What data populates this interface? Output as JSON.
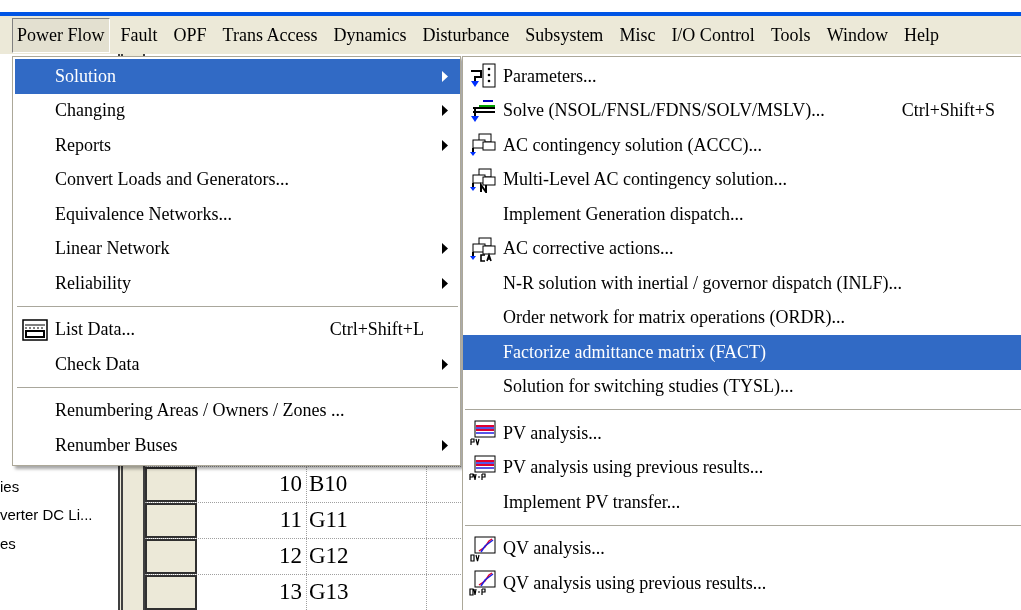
{
  "menubar": [
    {
      "label": "Power Flow",
      "selected": true
    },
    {
      "label": "Fault",
      "selected": false
    },
    {
      "label": "OPF",
      "selected": false
    },
    {
      "label": "Trans Access",
      "selected": false
    },
    {
      "label": "Dynamics",
      "selected": false
    },
    {
      "label": "Disturbance",
      "selected": false
    },
    {
      "label": "Subsystem",
      "selected": false
    },
    {
      "label": "Misc",
      "selected": false
    },
    {
      "label": "I/O Control",
      "selected": false
    },
    {
      "label": "Tools",
      "selected": false
    },
    {
      "label": "Window",
      "selected": false
    },
    {
      "label": "Help",
      "selected": false
    }
  ],
  "menu": {
    "items": [
      {
        "kind": "item",
        "label": "Solution",
        "has_submenu": true,
        "selected": true
      },
      {
        "kind": "item",
        "label": "Changing",
        "has_submenu": true,
        "selected": false
      },
      {
        "kind": "item",
        "label": "Reports",
        "has_submenu": true,
        "selected": false
      },
      {
        "kind": "item",
        "label": "Convert Loads and Generators...",
        "has_submenu": false,
        "selected": false
      },
      {
        "kind": "item",
        "label": "Equivalence Networks...",
        "has_submenu": false,
        "selected": false
      },
      {
        "kind": "item",
        "label": "Linear Network",
        "has_submenu": true,
        "selected": false
      },
      {
        "kind": "item",
        "label": "Reliability",
        "has_submenu": true,
        "selected": false
      },
      {
        "kind": "separator"
      },
      {
        "kind": "item",
        "label": "List Data...",
        "shortcut": "Ctrl+Shift+L",
        "has_submenu": false,
        "selected": false
      },
      {
        "kind": "item",
        "label": "Check Data",
        "has_submenu": true,
        "selected": false
      },
      {
        "kind": "separator"
      },
      {
        "kind": "item",
        "label": "Renumbering Areas / Owners / Zones ...",
        "has_submenu": false,
        "selected": false
      },
      {
        "kind": "item",
        "label": "Renumber Buses",
        "has_submenu": true,
        "selected": false
      }
    ]
  },
  "submenu": {
    "items": [
      {
        "kind": "item",
        "label": "Parameters...",
        "selected": false
      },
      {
        "kind": "item",
        "label": "Solve (NSOL/FNSL/FDNS/SOLV/MSLV)...",
        "shortcut": "Ctrl+Shift+S",
        "selected": false
      },
      {
        "kind": "item",
        "label": "AC contingency solution (ACCC)...",
        "selected": false
      },
      {
        "kind": "item",
        "label": "Multi-Level AC contingency solution...",
        "selected": false
      },
      {
        "kind": "item",
        "label": "Implement Generation dispatch...",
        "selected": false
      },
      {
        "kind": "item",
        "label": "AC corrective actions...",
        "selected": false
      },
      {
        "kind": "item",
        "label": "N-R solution with inertial / governor dispatch (INLF)...",
        "selected": false
      },
      {
        "kind": "item",
        "label": "Order network for matrix operations (ORDR)...",
        "selected": false
      },
      {
        "kind": "item",
        "label": "Factorize admittance matrix (FACT)",
        "selected": true
      },
      {
        "kind": "item",
        "label": "Solution for switching studies (TYSL)...",
        "selected": false
      },
      {
        "kind": "separator"
      },
      {
        "kind": "item",
        "label": "PV analysis...",
        "selected": false
      },
      {
        "kind": "item",
        "label": "PV analysis using previous results...",
        "selected": false
      },
      {
        "kind": "item",
        "label": "Implement PV transfer...",
        "selected": false
      },
      {
        "kind": "separator"
      },
      {
        "kind": "item",
        "label": "QV analysis...",
        "selected": false
      },
      {
        "kind": "item",
        "label": "QV analysis using previous results...",
        "selected": false
      }
    ]
  },
  "tree": {
    "items": [
      "ies",
      "verter DC Li...",
      "es"
    ]
  },
  "table": {
    "rows": [
      {
        "number": "10",
        "name": "B10"
      },
      {
        "number": "11",
        "name": "G11"
      },
      {
        "number": "12",
        "name": "G12"
      },
      {
        "number": "13",
        "name": "G13"
      }
    ]
  }
}
